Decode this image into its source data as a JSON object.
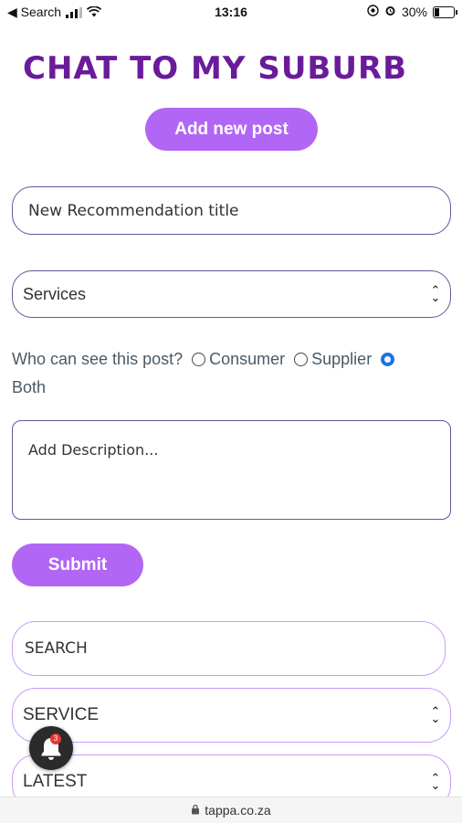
{
  "status_bar": {
    "back_label": "◀ Search",
    "time": "13:16",
    "battery": "30%",
    "battery_level": 0.3
  },
  "page": {
    "title": "CHAT TO MY SUBURB",
    "add_post_label": "Add new post"
  },
  "form": {
    "title_placeholder": "New Recommendation title",
    "category_value": "Services",
    "audience": {
      "question": "Who can see this post?",
      "options": [
        "Consumer",
        "Supplier",
        "Both"
      ],
      "selected": "Both"
    },
    "description_placeholder": "Add Description...",
    "submit_label": "Submit"
  },
  "filters": {
    "search_placeholder": "SEARCH",
    "service_value": "SERVICE",
    "sort_value": "LATEST"
  },
  "notification": {
    "count": "3",
    "accent": "#e53935"
  },
  "browser": {
    "url": "tappa.co.za"
  },
  "colors": {
    "title": "#6a1b9a",
    "button": "#b266f5",
    "field_border": "#5a5aa0",
    "filter_border": "#c79cf7",
    "radio_selected": "#1a73e8"
  }
}
